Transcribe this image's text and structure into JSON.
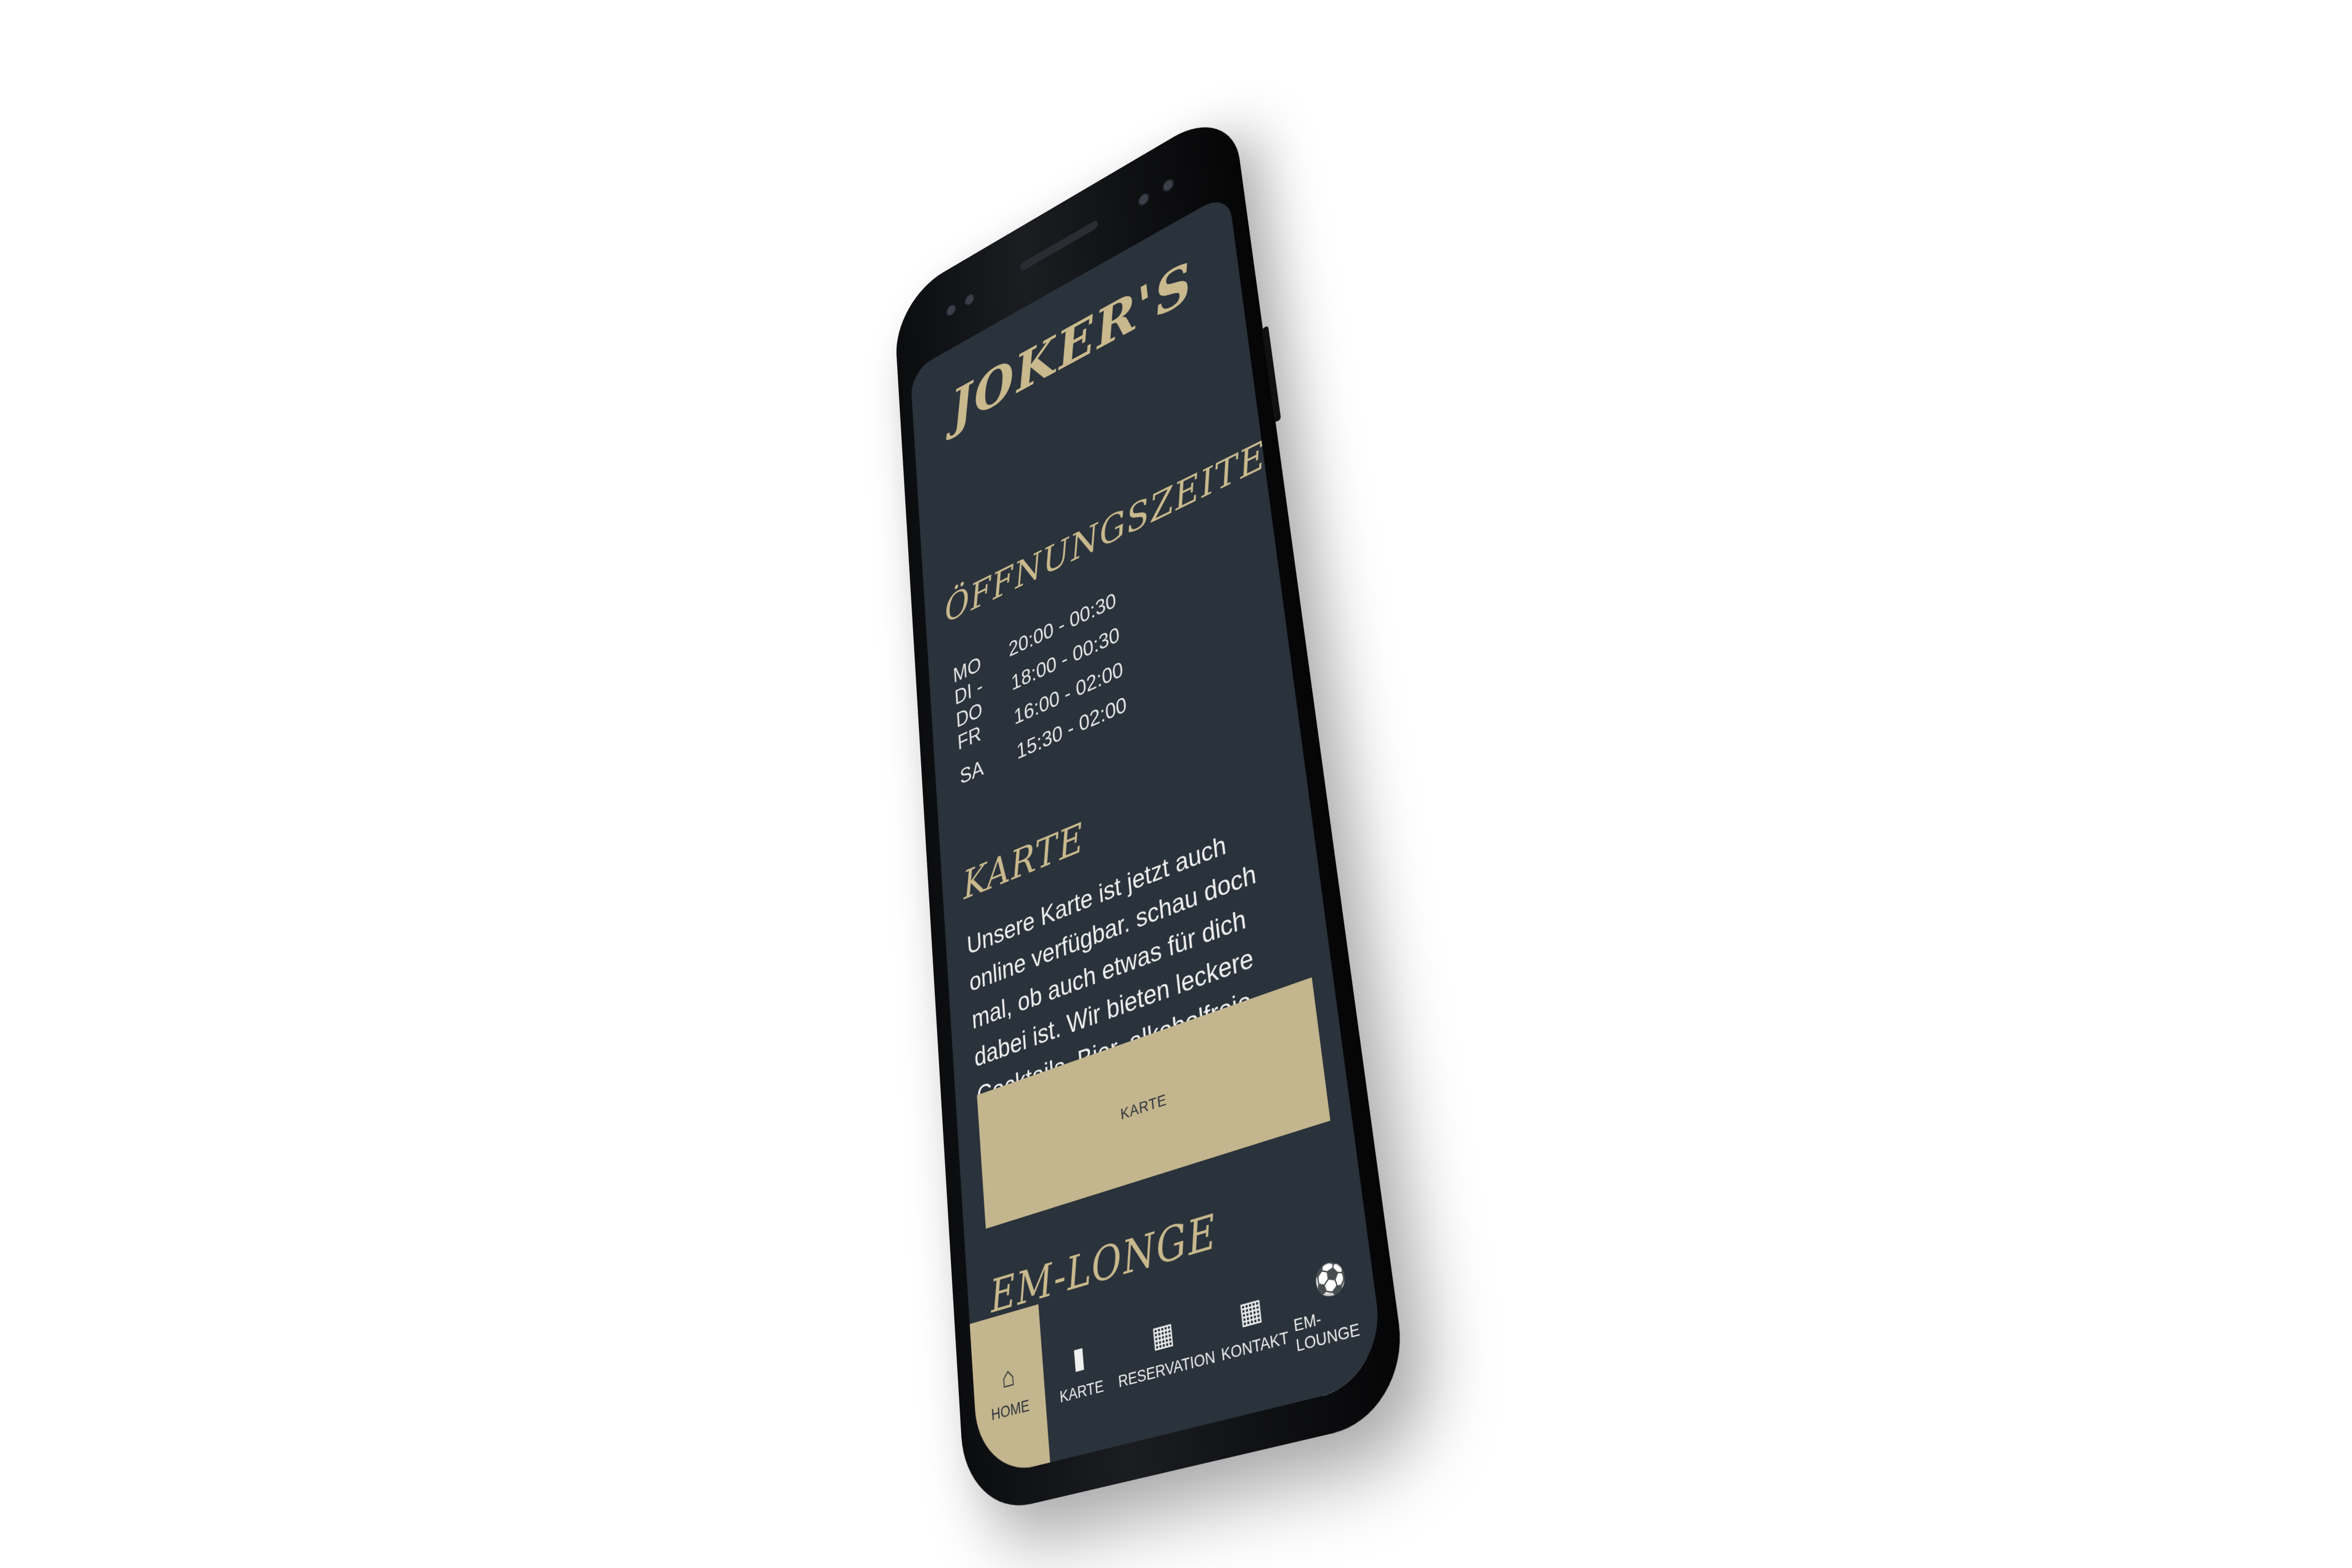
{
  "app": {
    "brand": "JOKER'S"
  },
  "hours": {
    "title": "ÖFFNUNGSZEITEN",
    "rows": [
      {
        "day": "MO",
        "time": "20:00 - 00:30"
      },
      {
        "day": "DI - DO",
        "time": "18:00 - 00:30"
      },
      {
        "day": "FR",
        "time": "16:00 - 02:00"
      },
      {
        "day": "SA",
        "time": "15:30 - 02:00"
      }
    ]
  },
  "karte": {
    "title": "KARTE",
    "text": "Unsere Karte ist jetzt auch online verfügbar. schau doch mal, ob auch etwas für dich dabei ist. Wir bieten leckere Cocktails, Bier, alkoholfreie Getränke sowie Snacks an.",
    "button_label": "KARTE"
  },
  "em": {
    "title": "EM-LONGE"
  },
  "nav": {
    "items": [
      {
        "label": "HOME",
        "icon": "home-icon",
        "glyph": "⌂"
      },
      {
        "label": "KARTE",
        "icon": "menu-card-icon",
        "glyph": "▮"
      },
      {
        "label": "RESERVATION",
        "icon": "calendar-icon",
        "glyph": "▦"
      },
      {
        "label": "KONTAKT",
        "icon": "contact-card-icon",
        "glyph": "▦"
      },
      {
        "label": "EM-LOUNGE",
        "icon": "soccer-ball-icon",
        "glyph": "⚽"
      }
    ]
  },
  "colors": {
    "background": "#2a323b",
    "accent": "#c3b58d",
    "text": "#f0f0f0"
  }
}
